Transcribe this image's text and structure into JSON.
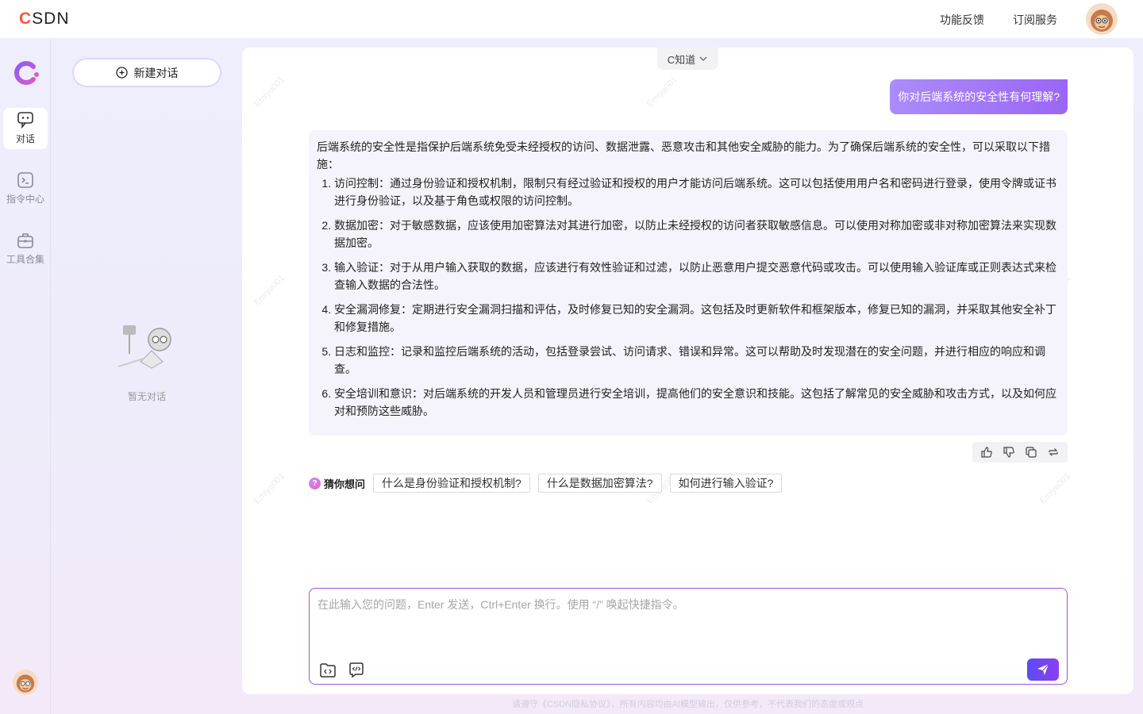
{
  "header": {
    "logo": "CSDN",
    "links": [
      "功能反馈",
      "订阅服务"
    ]
  },
  "rail": {
    "items": [
      {
        "label": "对话"
      },
      {
        "label": "指令中心"
      },
      {
        "label": "工具合集"
      }
    ]
  },
  "history": {
    "new_chat_label": "新建对话",
    "empty_text": "暂无对话"
  },
  "chat": {
    "model": "C知道",
    "user_message": "你对后端系统的安全性有何理解?",
    "answer_intro": "后端系统的安全性是指保护后端系统免受未经授权的访问、数据泄露、恶意攻击和其他安全威胁的能力。为了确保后端系统的安全性，可以采取以下措施：",
    "answer_items": [
      "访问控制：通过身份验证和授权机制，限制只有经过验证和授权的用户才能访问后端系统。这可以包括使用用户名和密码进行登录，使用令牌或证书进行身份验证，以及基于角色或权限的访问控制。",
      "数据加密：对于敏感数据，应该使用加密算法对其进行加密，以防止未经授权的访问者获取敏感信息。可以使用对称加密或非对称加密算法来实现数据加密。",
      "输入验证：对于从用户输入获取的数据，应该进行有效性验证和过滤，以防止恶意用户提交恶意代码或攻击。可以使用输入验证库或正则表达式来检查输入数据的合法性。",
      "安全漏洞修复：定期进行安全漏洞扫描和评估，及时修复已知的安全漏洞。这包括及时更新软件和框架版本，修复已知的漏洞，并采取其他安全补丁和修复措施。",
      "日志和监控：记录和监控后端系统的活动，包括登录尝试、访问请求、错误和异常。这可以帮助及时发现潜在的安全问题，并进行相应的响应和调查。",
      "安全培训和意识：对后端系统的开发人员和管理员进行安全培训，提高他们的安全意识和技能。这包括了解常见的安全威胁和攻击方式，以及如何应对和预防这些威胁。"
    ],
    "guess_label": "猜你想问",
    "suggestions": [
      "什么是身份验证和授权机制?",
      "什么是数据加密算法?",
      "如何进行输入验证?"
    ]
  },
  "input": {
    "placeholder": "在此输入您的问题，Enter 发送，Ctrl+Enter 换行。使用 “/” 唤起快捷指令。",
    "value": ""
  },
  "footer": "请遵守《CSDN隐私协议》，所有内容均由AI模型输出，仅供参考，不代表我们的态度或观点",
  "watermark": "Emiya001",
  "colors": {
    "accent": "#9a66f4",
    "brand_red": "#fc5531",
    "send_start": "#5a4cf5",
    "send_end": "#8b3ff0"
  }
}
